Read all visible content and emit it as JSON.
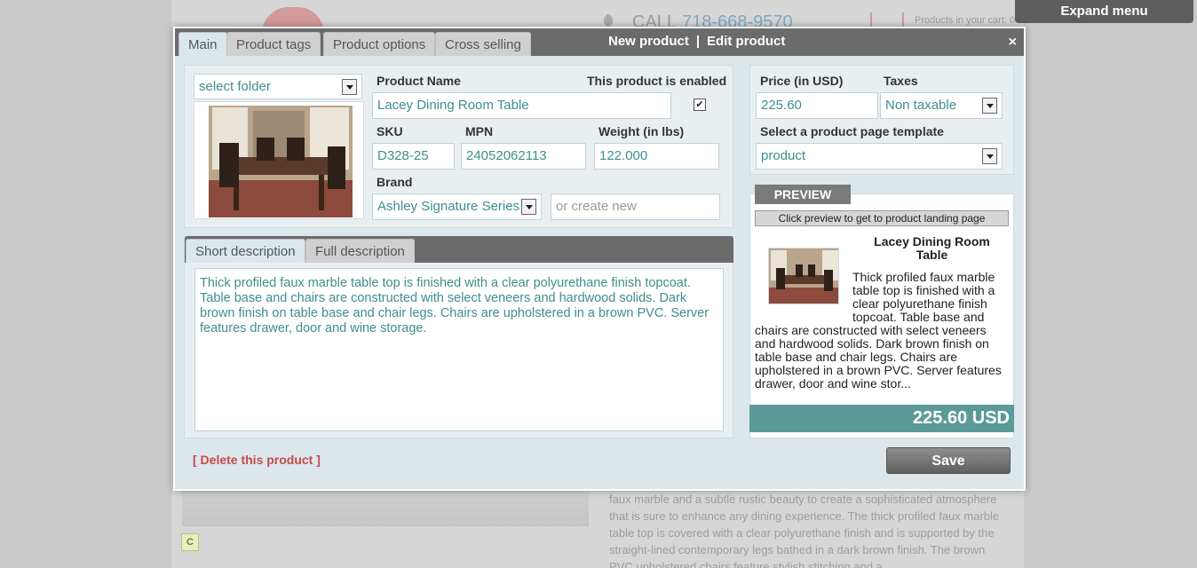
{
  "background": {
    "call_label": "CALL",
    "phone": "718-668-9570",
    "cart_text": "Products in your cart: 0",
    "badge": "C",
    "text": "faux marble and a subtle rustic beauty to create a sophisticated atmosphere that is sure to enhance any dining experience. The thick profiled faux marble table top is covered with a clear polyurethane finish and is supported by the straight-lined contemporary legs bathed in a dark brown finish. The brown PVC upholstered chairs feature stylish stitching and a"
  },
  "expand_menu": "Expand menu",
  "modal": {
    "tabs": [
      "Main",
      "Product tags",
      "Product options",
      "Cross selling"
    ],
    "new_product": "New product",
    "separator": "|",
    "edit_product": "Edit product",
    "close": "×"
  },
  "form": {
    "folder": "select folder",
    "product_name_label": "Product Name",
    "product_name": "Lacey Dining Room Table",
    "enabled_label": "This product is enabled",
    "enabled": "✔",
    "sku_label": "SKU",
    "sku": "D328-25",
    "mpn_label": "MPN",
    "mpn": "24052062113",
    "weight_label": "Weight (in lbs)",
    "weight": "122.000",
    "brand_label": "Brand",
    "brand": "Ashley Signature Series",
    "brand_new_placeholder": "or create new",
    "price_label": "Price (in USD)",
    "price": "225.60",
    "taxes_label": "Taxes",
    "taxes": "Non taxable",
    "template_label": "Select a product page template",
    "template": "product"
  },
  "description": {
    "tabs": [
      "Short description",
      "Full description"
    ],
    "text": "Thick profiled faux marble table top is finished with a clear polyurethane finish topcoat. Table base and chairs are constructed with select veneers and hardwood solids. Dark brown finish on table base and chair legs. Chairs are upholstered in a brown PVC. Server features drawer, door and wine storage."
  },
  "preview": {
    "tag": "PREVIEW",
    "button": "Click preview to get to product landing page",
    "title": "Lacey Dining Room Table",
    "desc": "Thick profiled faux marble table top is finished with a clear polyurethane finish topcoat. Table base and chairs are constructed with select veneers and hardwood solids. Dark brown finish on table base and chair legs. Chairs are upholstered in a brown PVC. Server features drawer, door and wine stor...",
    "price": "225.60 USD"
  },
  "actions": {
    "delete": "[ Delete this product ]",
    "save": "Save"
  },
  "colors": {
    "accent": "#5c9a9a",
    "input_text": "#3e8e8e",
    "header": "#6b6b6b",
    "delete": "#c54a4a"
  }
}
